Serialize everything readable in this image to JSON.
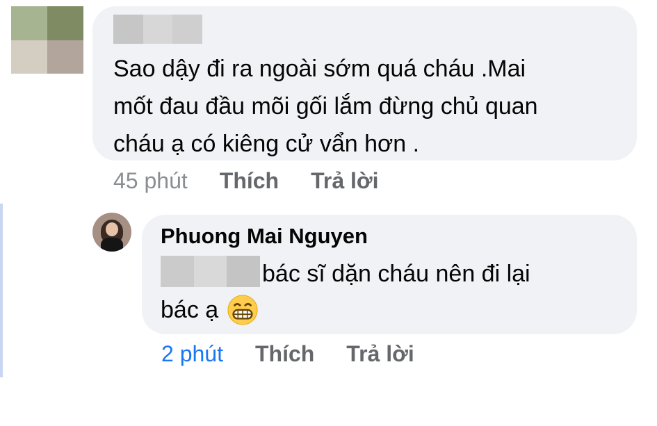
{
  "comment": {
    "text_lines": [
      "Sao dậy đi ra ngoài sớm quá cháu .Mai",
      "mốt đau đầu mõi gối lắm đừng chủ quan",
      "cháu ạ có kiêng cử vẩn hơn ."
    ],
    "time": "45 phút",
    "like_label": "Thích",
    "reply_label": "Trả lời"
  },
  "reply": {
    "author": "Phuong Mai Nguyen",
    "line1": "bác sĩ dặn cháu nên đi lại",
    "line2": "bác ạ",
    "emoji": "grinning-face-emoji",
    "time": "2 phút",
    "like_label": "Thích",
    "reply_label": "Trả lời"
  },
  "colors": {
    "bubble_bg": "#f0f2f5",
    "meta_text": "#65676b",
    "recent_time": "#1877f2",
    "thread_line": "#c9d6f2"
  }
}
